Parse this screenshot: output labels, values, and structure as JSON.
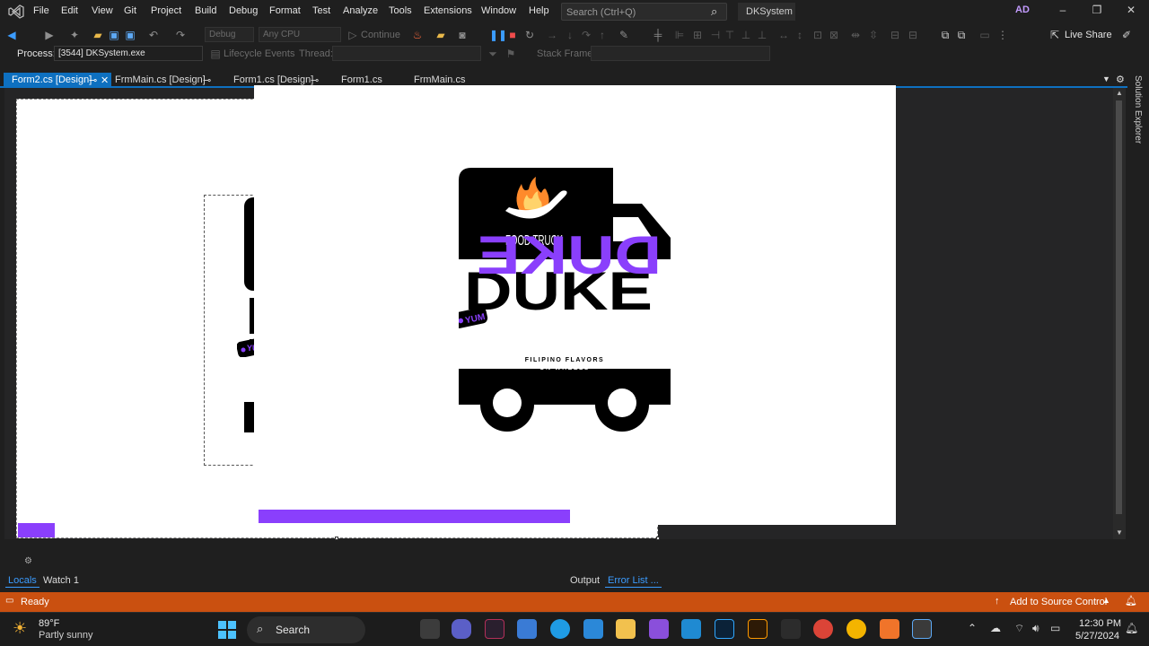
{
  "menu": {
    "items": [
      "File",
      "Edit",
      "View",
      "Git",
      "Project",
      "Build",
      "Debug",
      "Format",
      "Test",
      "Analyze",
      "Tools",
      "Extensions",
      "Window",
      "Help"
    ],
    "search_placeholder": "Search (Ctrl+Q)",
    "solution_name": "DKSystem",
    "account_initials": "AD"
  },
  "toolbar": {
    "config": "Debug",
    "platform": "Any CPU",
    "continue_label": "Continue",
    "live_share": "Live Share",
    "process_label": "Process:",
    "process_value": "[3544] DKSystem.exe",
    "lifecycle_label": "Lifecycle Events",
    "thread_label": "Thread:",
    "stack_frame_label": "Stack Frame:"
  },
  "tabs": [
    {
      "label": "Form2.cs [Design]",
      "active": true
    },
    {
      "label": "FrmMain.cs [Design]",
      "active": false
    },
    {
      "label": "Form1.cs [Design]",
      "active": false
    },
    {
      "label": "Form1.cs",
      "active": false
    },
    {
      "label": "FrmMain.cs",
      "active": false
    }
  ],
  "side_panel": {
    "label": "Solution Explorer"
  },
  "logo": {
    "top_label": "FOOD TRUCK",
    "word1": "DUKE",
    "word2": "DUKE",
    "tag": "YUM",
    "tagline_line1": "FILIPINO FLAVORS",
    "tagline_line2": "ON WHEELS",
    "accent_color": "#8a3ffc"
  },
  "bottom_panels": {
    "left_tabs": [
      "Locals",
      "Watch 1"
    ],
    "right_tabs": [
      "Output",
      "Error List ..."
    ]
  },
  "status": {
    "text": "Ready",
    "source_control": "Add to Source Control",
    "color": "#ca5010"
  },
  "taskbar": {
    "weather_temp": "89°F",
    "weather_desc": "Partly sunny",
    "search_label": "Search",
    "time": "12:30 PM",
    "date": "5/27/2024"
  }
}
